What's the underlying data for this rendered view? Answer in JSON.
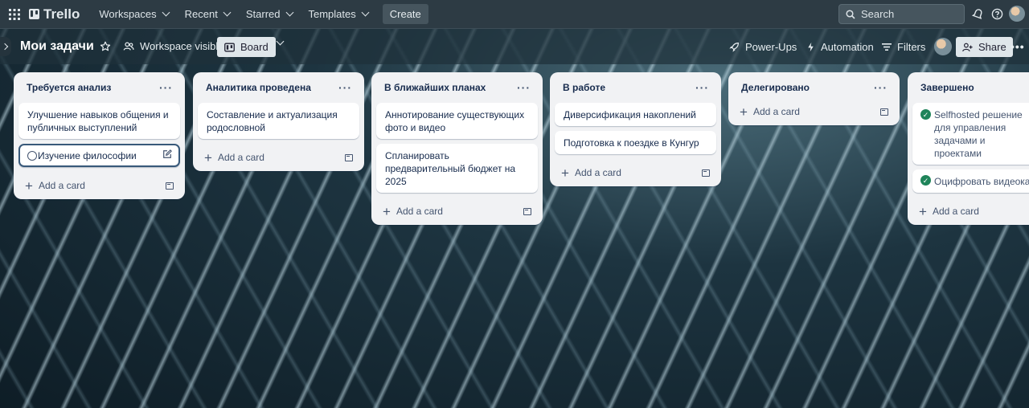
{
  "topnav": {
    "brand": "Trello",
    "workspaces": "Workspaces",
    "recent": "Recent",
    "starred": "Starred",
    "templates": "Templates",
    "create": "Create",
    "search_placeholder": "Search"
  },
  "board": {
    "title": "Мои задачи",
    "visibility": "Workspace visible",
    "view": "Board",
    "power_ups": "Power-Ups",
    "automation": "Automation",
    "filters": "Filters",
    "share": "Share"
  },
  "add_card_label": "Add a card",
  "lists": [
    {
      "title": "Требуется анализ",
      "cards": [
        "Улучшение навыков общения и публичных выступлений",
        "Изучение философии"
      ]
    },
    {
      "title": "Аналитика проведена",
      "cards": [
        "Составление и актуализация родословной"
      ]
    },
    {
      "title": "В ближайших планах",
      "cards": [
        "Аннотирование существующих фото и видео",
        "Спланировать предварительный бюджет на 2025"
      ]
    },
    {
      "title": "В работе",
      "cards": [
        "Диверсификация накоплений",
        "Подготовка к поездке в Кунгур"
      ]
    },
    {
      "title": "Делегировано",
      "cards": []
    },
    {
      "title": "Завершено",
      "cards": [
        "Selfhosted решение для управления задачами и проектами",
        "Оцифровать видеокасс"
      ]
    }
  ],
  "colors": {
    "topbar": "#2d3b44",
    "list_bg": "#f1f2f4",
    "done_check": "#1f845a",
    "selected_border": "#38597a"
  }
}
